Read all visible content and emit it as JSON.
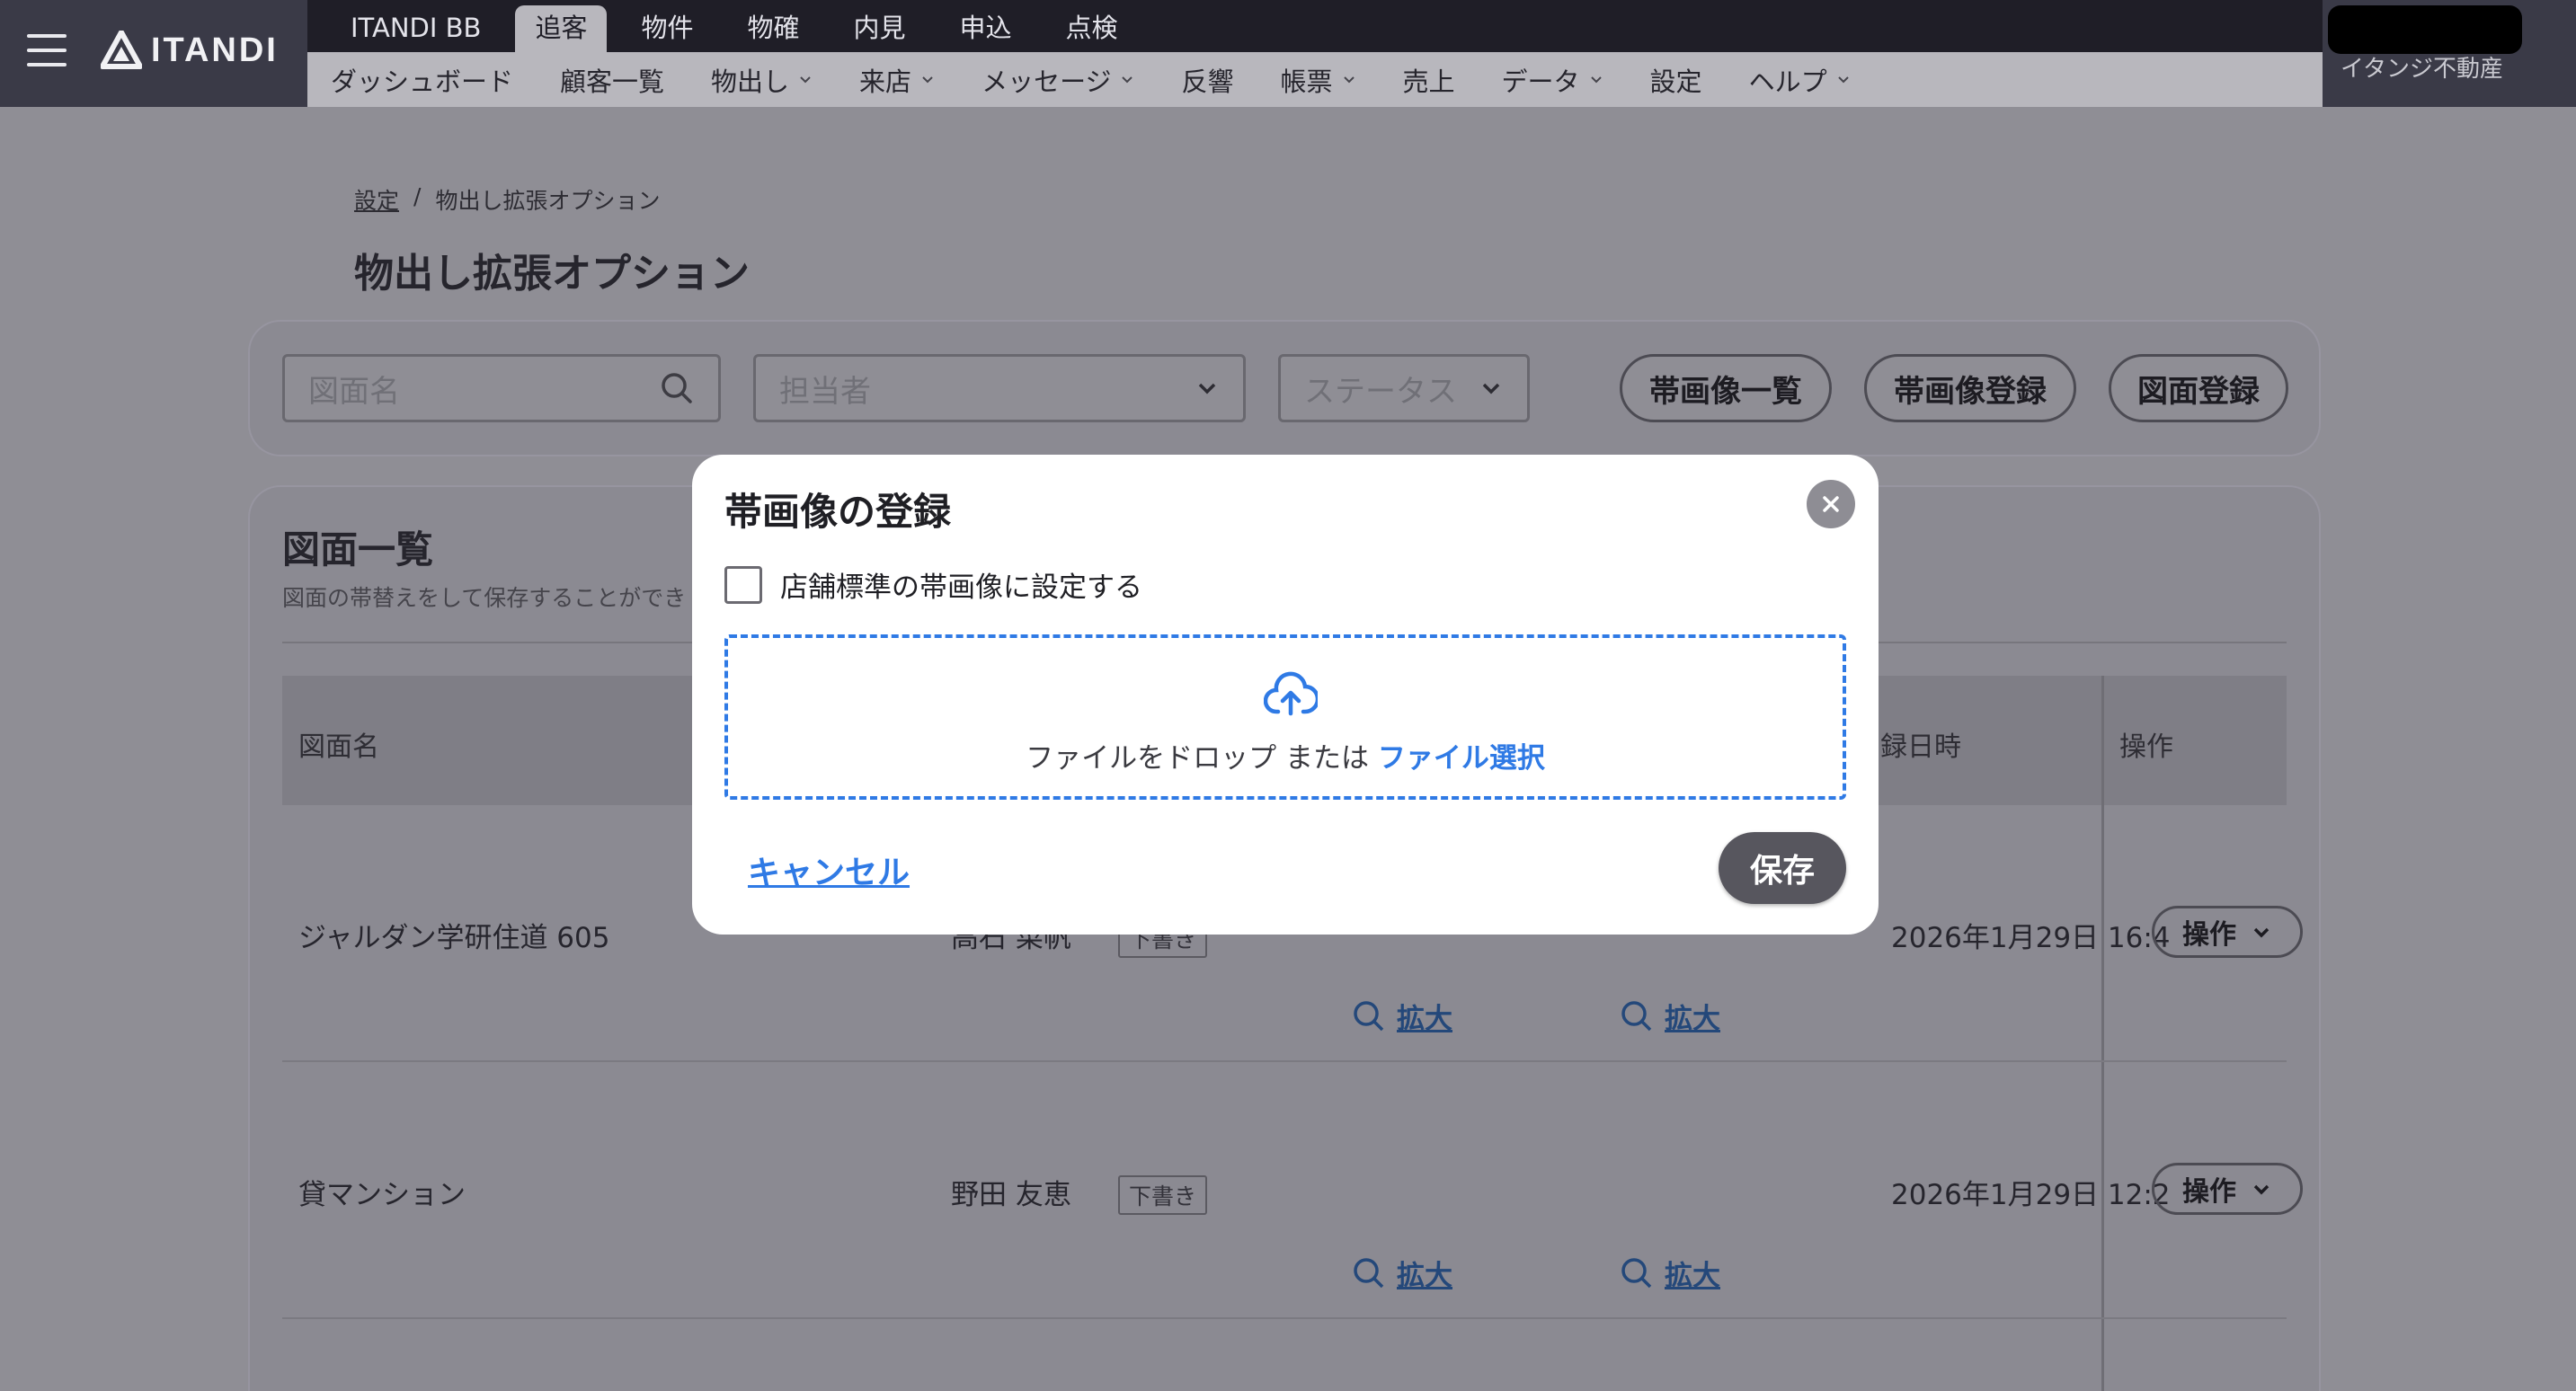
{
  "header": {
    "logo_text": "ITANDI",
    "top_tabs": [
      "ITANDI BB",
      "追客",
      "物件",
      "物確",
      "内見",
      "申込",
      "点検"
    ],
    "active_top_tab": "追客",
    "sub_nav": [
      {
        "label": "ダッシュボード",
        "has_dropdown": false
      },
      {
        "label": "顧客一覧",
        "has_dropdown": false
      },
      {
        "label": "物出し",
        "has_dropdown": true
      },
      {
        "label": "来店",
        "has_dropdown": true
      },
      {
        "label": "メッセージ",
        "has_dropdown": true
      },
      {
        "label": "反響",
        "has_dropdown": false
      },
      {
        "label": "帳票",
        "has_dropdown": true
      },
      {
        "label": "売上",
        "has_dropdown": false
      },
      {
        "label": "データ",
        "has_dropdown": true
      },
      {
        "label": "設定",
        "has_dropdown": false
      },
      {
        "label": "ヘルプ",
        "has_dropdown": true
      }
    ],
    "account_name": "イタンジ不動産"
  },
  "breadcrumb": {
    "parent": "設定",
    "separator": "/",
    "current": "物出し拡張オプション"
  },
  "page_title": "物出し拡張オプション",
  "filters": {
    "search_placeholder": "図面名",
    "staff_placeholder": "担当者",
    "status_placeholder": "ステータス",
    "buttons": [
      "帯画像一覧",
      "帯画像登録",
      "図面登録"
    ]
  },
  "list": {
    "title": "図面一覧",
    "description": "図面の帯替えをして保存することができ",
    "columns": {
      "name": "図面名",
      "registered": "録日時",
      "actions": "操作"
    },
    "rows": [
      {
        "name": "ジャルダン学研住道 605",
        "staff": "高石 菜帆",
        "status": "下書き",
        "date": "2026年1月29日 16:4",
        "zoom1": "拡大",
        "zoom2": "拡大",
        "action": "操作"
      },
      {
        "name": "貸マンション",
        "staff": "野田 友恵",
        "status": "下書き",
        "date": "2026年1月29日 12:2",
        "zoom1": "拡大",
        "zoom2": "拡大",
        "action": "操作"
      }
    ]
  },
  "modal": {
    "title": "帯画像の登録",
    "checkbox_label": "店舗標準の帯画像に設定する",
    "checkbox_checked": false,
    "drop_text": "ファイルをドロップ または ",
    "drop_link": "ファイル選択",
    "cancel_label": "キャンセル",
    "save_label": "保存"
  },
  "colors": {
    "accent": "#2f7ae5",
    "header_bg": "#1f1e27",
    "overlay": "#8f8e95"
  }
}
